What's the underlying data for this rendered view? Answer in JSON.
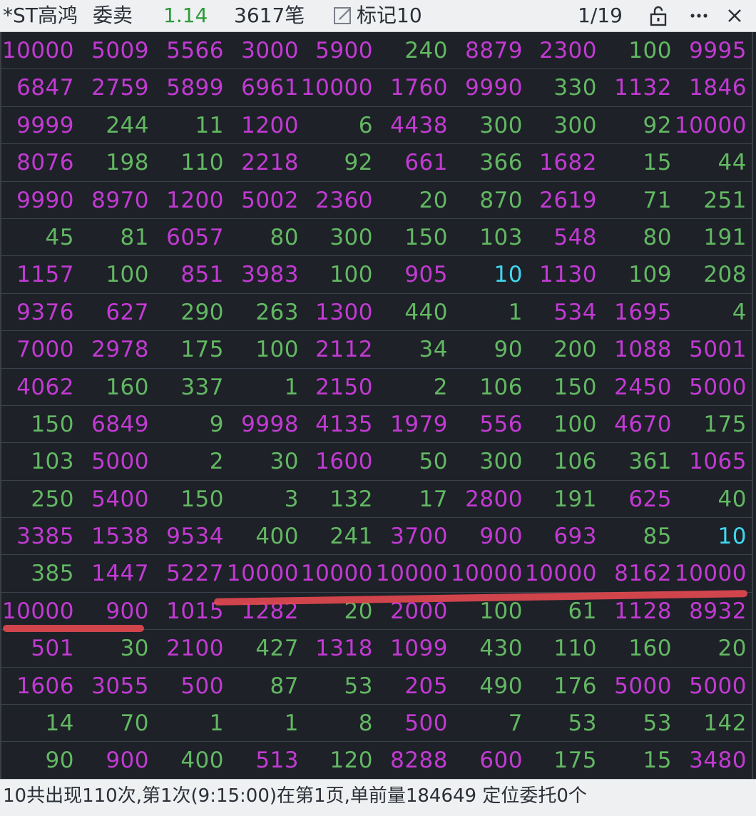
{
  "header": {
    "stock_name": "*ST高鸿",
    "side_label": "委卖",
    "price": "1.14",
    "count": "3617笔",
    "mark_label": "标记10",
    "page_indicator": "1/19",
    "colors": {
      "background": "#eef0f2",
      "price": "#2f9a3a"
    },
    "icons": [
      "edit-mark-icon",
      "unlock-icon",
      "more-icon",
      "close-icon"
    ]
  },
  "grid": {
    "colors": {
      "background": "#1e2128",
      "purple": "#c23ad3",
      "green": "#62b862",
      "cyan": "#3fd7ee",
      "annotation": "#e0484f"
    },
    "rows": [
      [
        [
          "10000",
          "p"
        ],
        [
          "5009",
          "p"
        ],
        [
          "5566",
          "p"
        ],
        [
          "3000",
          "p"
        ],
        [
          "5900",
          "p"
        ],
        [
          "240",
          "g"
        ],
        [
          "8879",
          "p"
        ],
        [
          "2300",
          "p"
        ],
        [
          "100",
          "g"
        ],
        [
          "9995",
          "p"
        ]
      ],
      [
        [
          "6847",
          "p"
        ],
        [
          "2759",
          "p"
        ],
        [
          "5899",
          "p"
        ],
        [
          "6961",
          "p"
        ],
        [
          "10000",
          "p"
        ],
        [
          "1760",
          "p"
        ],
        [
          "9990",
          "p"
        ],
        [
          "330",
          "g"
        ],
        [
          "1132",
          "p"
        ],
        [
          "1846",
          "p"
        ]
      ],
      [
        [
          "9999",
          "p"
        ],
        [
          "244",
          "g"
        ],
        [
          "11",
          "g"
        ],
        [
          "1200",
          "p"
        ],
        [
          "6",
          "g"
        ],
        [
          "4438",
          "p"
        ],
        [
          "300",
          "g"
        ],
        [
          "300",
          "g"
        ],
        [
          "92",
          "g"
        ],
        [
          "10000",
          "p"
        ]
      ],
      [
        [
          "8076",
          "p"
        ],
        [
          "198",
          "g"
        ],
        [
          "110",
          "g"
        ],
        [
          "2218",
          "p"
        ],
        [
          "92",
          "g"
        ],
        [
          "661",
          "p"
        ],
        [
          "366",
          "g"
        ],
        [
          "1682",
          "p"
        ],
        [
          "15",
          "g"
        ],
        [
          "44",
          "g"
        ]
      ],
      [
        [
          "9990",
          "p"
        ],
        [
          "8970",
          "p"
        ],
        [
          "1200",
          "p"
        ],
        [
          "5002",
          "p"
        ],
        [
          "2360",
          "p"
        ],
        [
          "20",
          "g"
        ],
        [
          "870",
          "g"
        ],
        [
          "2619",
          "p"
        ],
        [
          "71",
          "g"
        ],
        [
          "251",
          "g"
        ]
      ],
      [
        [
          "45",
          "g"
        ],
        [
          "81",
          "g"
        ],
        [
          "6057",
          "p"
        ],
        [
          "80",
          "g"
        ],
        [
          "300",
          "g"
        ],
        [
          "150",
          "g"
        ],
        [
          "103",
          "g"
        ],
        [
          "548",
          "p"
        ],
        [
          "80",
          "g"
        ],
        [
          "191",
          "g"
        ]
      ],
      [
        [
          "1157",
          "p"
        ],
        [
          "100",
          "g"
        ],
        [
          "851",
          "p"
        ],
        [
          "3983",
          "p"
        ],
        [
          "100",
          "g"
        ],
        [
          "905",
          "p"
        ],
        [
          "10",
          "c"
        ],
        [
          "1130",
          "p"
        ],
        [
          "109",
          "g"
        ],
        [
          "208",
          "g"
        ]
      ],
      [
        [
          "9376",
          "p"
        ],
        [
          "627",
          "p"
        ],
        [
          "290",
          "g"
        ],
        [
          "263",
          "g"
        ],
        [
          "1300",
          "p"
        ],
        [
          "440",
          "g"
        ],
        [
          "1",
          "g"
        ],
        [
          "534",
          "p"
        ],
        [
          "1695",
          "p"
        ],
        [
          "4",
          "g"
        ]
      ],
      [
        [
          "7000",
          "p"
        ],
        [
          "2978",
          "p"
        ],
        [
          "175",
          "g"
        ],
        [
          "100",
          "g"
        ],
        [
          "2112",
          "p"
        ],
        [
          "34",
          "g"
        ],
        [
          "90",
          "g"
        ],
        [
          "200",
          "g"
        ],
        [
          "1088",
          "p"
        ],
        [
          "5001",
          "p"
        ]
      ],
      [
        [
          "4062",
          "p"
        ],
        [
          "160",
          "g"
        ],
        [
          "337",
          "g"
        ],
        [
          "1",
          "g"
        ],
        [
          "2150",
          "p"
        ],
        [
          "2",
          "g"
        ],
        [
          "106",
          "g"
        ],
        [
          "150",
          "g"
        ],
        [
          "2450",
          "p"
        ],
        [
          "5000",
          "p"
        ]
      ],
      [
        [
          "150",
          "g"
        ],
        [
          "6849",
          "p"
        ],
        [
          "9",
          "g"
        ],
        [
          "9998",
          "p"
        ],
        [
          "4135",
          "p"
        ],
        [
          "1979",
          "p"
        ],
        [
          "556",
          "p"
        ],
        [
          "100",
          "g"
        ],
        [
          "4670",
          "p"
        ],
        [
          "175",
          "g"
        ]
      ],
      [
        [
          "103",
          "g"
        ],
        [
          "5000",
          "p"
        ],
        [
          "2",
          "g"
        ],
        [
          "30",
          "g"
        ],
        [
          "1600",
          "p"
        ],
        [
          "50",
          "g"
        ],
        [
          "300",
          "g"
        ],
        [
          "106",
          "g"
        ],
        [
          "361",
          "g"
        ],
        [
          "1065",
          "p"
        ]
      ],
      [
        [
          "250",
          "g"
        ],
        [
          "5400",
          "p"
        ],
        [
          "150",
          "g"
        ],
        [
          "3",
          "g"
        ],
        [
          "132",
          "g"
        ],
        [
          "17",
          "g"
        ],
        [
          "2800",
          "p"
        ],
        [
          "191",
          "g"
        ],
        [
          "625",
          "p"
        ],
        [
          "40",
          "g"
        ]
      ],
      [
        [
          "3385",
          "p"
        ],
        [
          "1538",
          "p"
        ],
        [
          "9534",
          "p"
        ],
        [
          "400",
          "g"
        ],
        [
          "241",
          "g"
        ],
        [
          "3700",
          "p"
        ],
        [
          "900",
          "p"
        ],
        [
          "693",
          "p"
        ],
        [
          "85",
          "g"
        ],
        [
          "10",
          "c"
        ]
      ],
      [
        [
          "385",
          "g"
        ],
        [
          "1447",
          "p"
        ],
        [
          "5227",
          "p"
        ],
        [
          "10000",
          "p"
        ],
        [
          "10000",
          "p"
        ],
        [
          "10000",
          "p"
        ],
        [
          "10000",
          "p"
        ],
        [
          "10000",
          "p"
        ],
        [
          "8162",
          "p"
        ],
        [
          "10000",
          "p"
        ]
      ],
      [
        [
          "10000",
          "p"
        ],
        [
          "900",
          "p"
        ],
        [
          "1015",
          "p"
        ],
        [
          "1282",
          "p"
        ],
        [
          "20",
          "g"
        ],
        [
          "2000",
          "p"
        ],
        [
          "100",
          "g"
        ],
        [
          "61",
          "g"
        ],
        [
          "1128",
          "p"
        ],
        [
          "8932",
          "p"
        ]
      ],
      [
        [
          "501",
          "p"
        ],
        [
          "30",
          "g"
        ],
        [
          "2100",
          "p"
        ],
        [
          "427",
          "g"
        ],
        [
          "1318",
          "p"
        ],
        [
          "1099",
          "p"
        ],
        [
          "430",
          "g"
        ],
        [
          "110",
          "g"
        ],
        [
          "160",
          "g"
        ],
        [
          "20",
          "g"
        ]
      ],
      [
        [
          "1606",
          "p"
        ],
        [
          "3055",
          "p"
        ],
        [
          "500",
          "p"
        ],
        [
          "87",
          "g"
        ],
        [
          "53",
          "g"
        ],
        [
          "205",
          "p"
        ],
        [
          "490",
          "g"
        ],
        [
          "176",
          "g"
        ],
        [
          "5000",
          "p"
        ],
        [
          "5000",
          "p"
        ]
      ],
      [
        [
          "14",
          "g"
        ],
        [
          "70",
          "g"
        ],
        [
          "1",
          "g"
        ],
        [
          "1",
          "g"
        ],
        [
          "8",
          "g"
        ],
        [
          "500",
          "p"
        ],
        [
          "7",
          "g"
        ],
        [
          "53",
          "g"
        ],
        [
          "53",
          "g"
        ],
        [
          "142",
          "g"
        ]
      ],
      [
        [
          "90",
          "g"
        ],
        [
          "900",
          "p"
        ],
        [
          "400",
          "g"
        ],
        [
          "513",
          "p"
        ],
        [
          "120",
          "g"
        ],
        [
          "8288",
          "p"
        ],
        [
          "600",
          "p"
        ],
        [
          "175",
          "g"
        ],
        [
          "15",
          "g"
        ],
        [
          "3480",
          "p"
        ]
      ]
    ]
  },
  "status": {
    "text": "10共出现110次,第1次(9:15:00)在第1页,单前量184649   定位委托0个"
  }
}
